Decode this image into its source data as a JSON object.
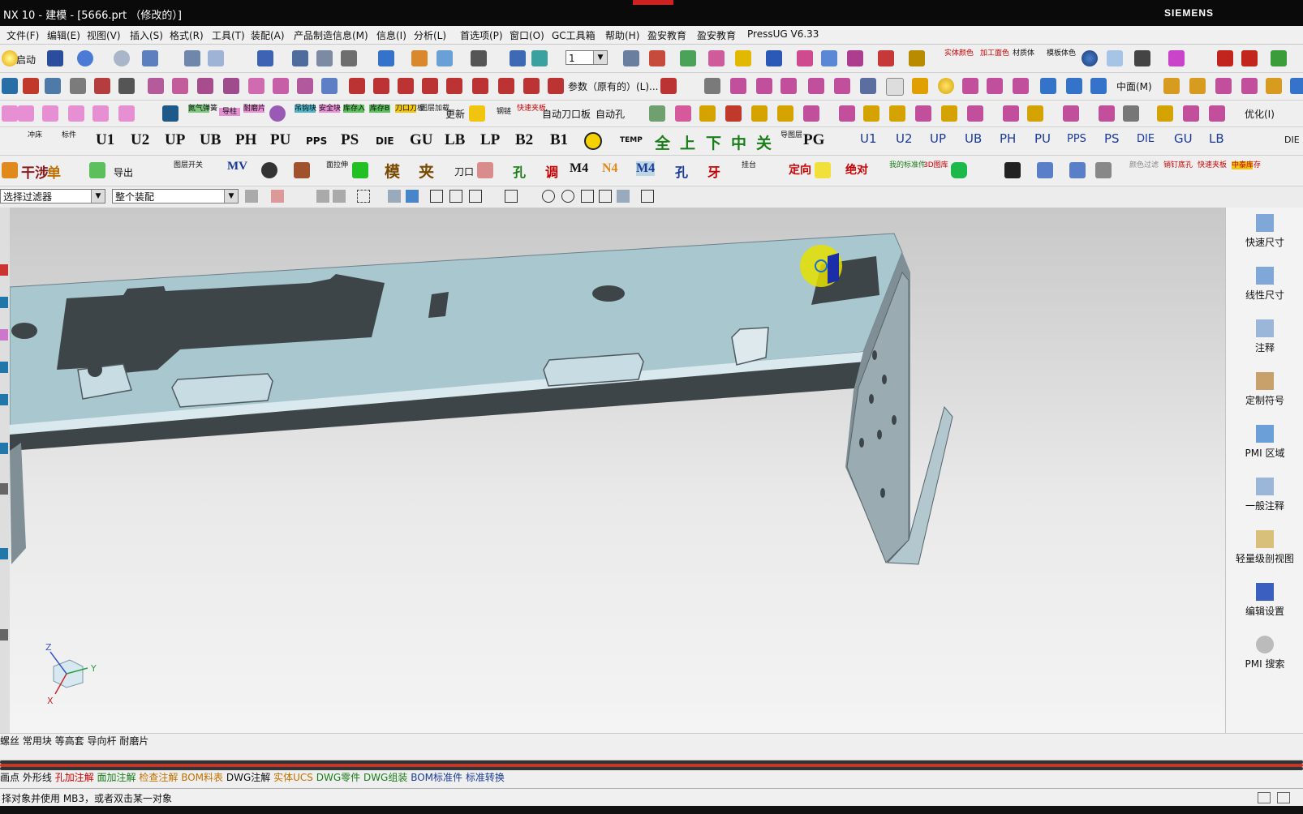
{
  "window": {
    "title": "NX 10 - 建模 - [5666.prt （修改的）]",
    "brand": "SIEMENS"
  },
  "menu": [
    "文件(F)",
    "编辑(E)",
    "视图(V)",
    "插入(S)",
    "格式(R)",
    "工具(T)",
    "装配(A)",
    "产品制造信息(M)",
    "信息(I)",
    "分析(L)",
    "首选项(P)",
    "窗口(O)",
    "GC工具箱",
    "帮助(H)",
    "盈安教育",
    "盈安教育",
    "PressUG V6.33"
  ],
  "toolbar1": {
    "start_label": "启动",
    "layer_value": "1",
    "labels": [
      "实体颜色",
      "加工面色",
      "材质体",
      "模板体色"
    ]
  },
  "toolbar2": {
    "param_label": "参数（原有的）(L)...",
    "middle_face_label": "中面(M)"
  },
  "toolbar3": {
    "labels": [
      "氮气弹簧",
      "导柱",
      "耐磨片",
      "吊钩块",
      "安全块",
      "库存入",
      "库存B",
      "刀口刀板",
      "图层加载",
      "更新",
      "钢链",
      "快速夹板",
      "自动刀口板",
      "自动孔",
      "优化(I)"
    ]
  },
  "toolbar4": {
    "labels": [
      "冲床",
      "标件",
      "U1",
      "U2",
      "UP",
      "UB",
      "PH",
      "PU",
      "PPS",
      "PS",
      "DIE",
      "GU",
      "LB",
      "LP",
      "B2",
      "B1",
      "TEMP",
      "全",
      "上",
      "下",
      "中",
      "关",
      "导图层",
      "PG",
      "U1",
      "U2",
      "UP",
      "UB",
      "PH",
      "PU",
      "PPS",
      "PS",
      "DIE",
      "GU",
      "LB",
      "DIE"
    ]
  },
  "toolbar5": {
    "labels": [
      "干涉",
      "单",
      "导出",
      "图层开关",
      "MV",
      "面拉伸",
      "模",
      "夹",
      "刀口",
      "孔",
      "调",
      "M4",
      "N4",
      "M4",
      "孔",
      "牙",
      "挂台",
      "定向",
      "绝对",
      "我的标准件",
      "3D图库",
      "颜色过滤",
      "销钉底孔",
      "快速夹板",
      "中泰库存"
    ]
  },
  "filterbar": {
    "filter_value": "选择过滤器",
    "scope_value": "整个装配"
  },
  "viewport": {
    "axis_labels": [
      "Z",
      "Y",
      "X"
    ]
  },
  "right_panel": [
    {
      "label": "快速尺寸",
      "icon": "quick-dimension-icon"
    },
    {
      "label": "线性尺寸",
      "icon": "linear-dimension-icon"
    },
    {
      "label": "注释",
      "icon": "note-icon"
    },
    {
      "label": "定制符号",
      "icon": "custom-symbol-icon"
    },
    {
      "label": "PMI 区域",
      "icon": "pmi-region-icon"
    },
    {
      "label": "一般注释",
      "icon": "general-note-icon"
    },
    {
      "label": "轻量级剖视图",
      "icon": "section-view-icon"
    },
    {
      "label": "编辑设置",
      "icon": "edit-settings-icon"
    },
    {
      "label": "PMI 搜索",
      "icon": "pmi-search-icon"
    }
  ],
  "bottom_bar1": {
    "labels": [
      "螺丝",
      "常用块",
      "等高套",
      "导向杆",
      "耐磨片"
    ]
  },
  "bottom_bar2": {
    "labels": [
      "画点",
      "外形线",
      "孔加注解",
      "面加注解",
      "检查注解",
      "BOM料表",
      "DWG注解",
      "实体UCS",
      "DWG零件",
      "DWG组装",
      "BOM标准件",
      "标准转换"
    ]
  },
  "status": {
    "message": "择对象并使用 MB3，或者双击某一对象"
  },
  "colors": {
    "part_face": "#a8c7cf",
    "part_dark": "#3d4548",
    "highlight": "#e6e000",
    "titlebar": "#0a0a0a"
  }
}
